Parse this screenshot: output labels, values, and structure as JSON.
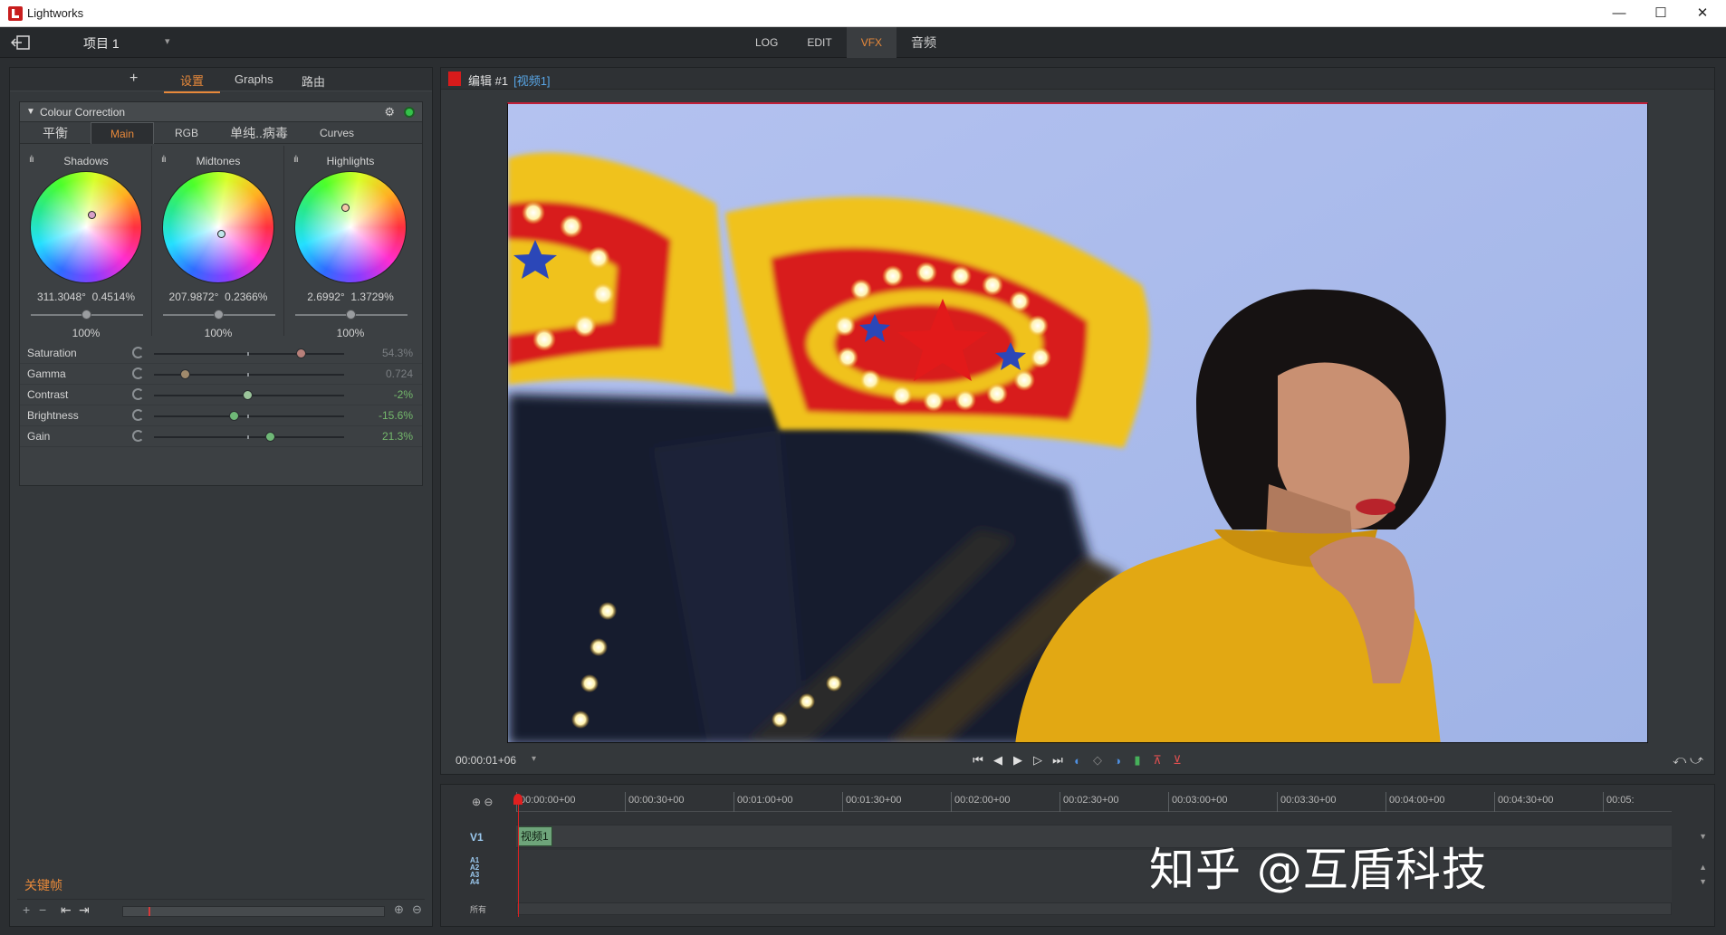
{
  "window": {
    "title": "Lightworks",
    "minimize": "—",
    "maximize": "☐",
    "close": "✕"
  },
  "topbar": {
    "project": "项目 1",
    "project_arrow": "▾",
    "tabs": [
      {
        "label": "LOG"
      },
      {
        "label": "EDIT"
      },
      {
        "label": "VFX",
        "active": true
      },
      {
        "label": "音频"
      }
    ]
  },
  "left_panel": {
    "add": "+",
    "tabs": [
      {
        "label": "设置",
        "active": true
      },
      {
        "label": "Graphs"
      },
      {
        "label": "路由"
      }
    ],
    "effect": {
      "collapse": "▼",
      "name": "Colour Correction",
      "gear": "⚙",
      "enabled_color": "#34c24a",
      "tabs": [
        {
          "label": "平衡"
        },
        {
          "label": "Main",
          "active": true
        },
        {
          "label": "RGB"
        },
        {
          "label": "单纯..病毒"
        },
        {
          "label": "Curves"
        }
      ],
      "bars_icon": "ılı",
      "wheels": [
        {
          "label": "Shadows",
          "hue": "311.3048°",
          "sat": "0.4514%",
          "master": "100%",
          "master_level": 0.5
        },
        {
          "label": "Midtones",
          "hue": "207.9872°",
          "sat": "0.2366%",
          "master": "100%",
          "master_level": 0.5
        },
        {
          "label": "Highlights",
          "hue": "2.6992°",
          "sat": "1.3729%",
          "master": "100%",
          "master_level": 0.5
        }
      ],
      "params": [
        {
          "label": "Saturation",
          "value": "54.3%",
          "level": 0.77,
          "knob_color": "#b8807a",
          "value_color": "#7a7e82"
        },
        {
          "label": "Gamma",
          "value": "0.724",
          "level": 0.16,
          "knob_color": "#a08a6c",
          "value_color": "#7a7e82"
        },
        {
          "label": "Contrast",
          "value": "-2%",
          "level": 0.49,
          "knob_color": "#9cc59b",
          "value_color": "#74b86c"
        },
        {
          "label": "Brightness",
          "value": "-15.6%",
          "level": 0.42,
          "knob_color": "#6fb877",
          "value_color": "#74b86c"
        },
        {
          "label": "Gain",
          "value": "21.3%",
          "level": 0.61,
          "knob_color": "#6fb877",
          "value_color": "#74b86c"
        }
      ]
    },
    "keyframes": {
      "label": "关键帧",
      "add": "+",
      "remove": "−",
      "prev": "⇤",
      "next": "⇥",
      "zoom_in": "⊕",
      "zoom_out": "⊖"
    }
  },
  "viewer": {
    "title": "编辑 #1",
    "track_tag": "[视频1]",
    "timecode": "00:00:01+06",
    "timecode_arrow": "▾",
    "controls": [
      "⏮",
      "◀",
      "▶",
      "▷",
      "⏭",
      "◐",
      "◇",
      "◑",
      "▮",
      "⊼",
      "⊻"
    ],
    "right_controls": "⤺ ⤻"
  },
  "timeline": {
    "zoom": "⊕ ⊖",
    "ruler": [
      "00:00:00+00",
      "00:00:30+00",
      "00:01:00+00",
      "00:01:30+00",
      "00:02:00+00",
      "00:02:30+00",
      "00:03:00+00",
      "00:03:30+00",
      "00:04:00+00",
      "00:04:30+00",
      "00:05:"
    ],
    "tracks": {
      "video": "V1",
      "audio": [
        "A1",
        "A2",
        "A3",
        "A4"
      ],
      "all": "所有"
    },
    "clip": "视频1",
    "watermark": "知乎 @互盾科技"
  }
}
